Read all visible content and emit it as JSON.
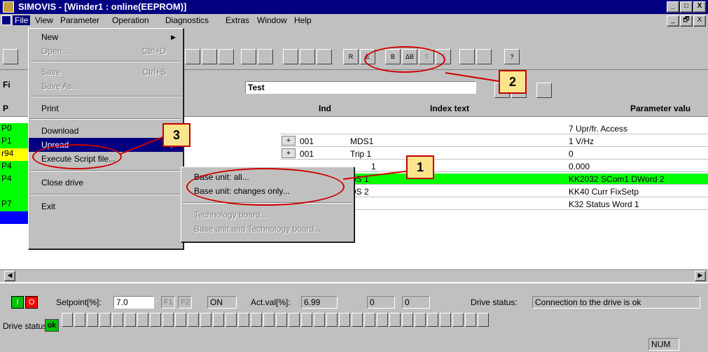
{
  "window": {
    "title": "SIMOVIS  -  [Winder1 : online(EEPROM)]",
    "controls": [
      "_",
      "□",
      "X"
    ],
    "child_controls": [
      "_",
      "🗗",
      "X"
    ]
  },
  "menubar": [
    "File",
    "View",
    "Parameter",
    "Operation",
    "Diagnostics",
    "Extras",
    "Window",
    "Help"
  ],
  "file_menu": {
    "new": "New",
    "open": "Open...",
    "open_shortcut": "Ctrl+D",
    "save": "Save",
    "save_shortcut": "Ctrl+S",
    "save_as": "Save As...",
    "print": "Print",
    "download": "Download",
    "upread": "Upread",
    "execute_script": "Execute Script file...",
    "close_drive": "Close drive",
    "exit": "Exit"
  },
  "upread_submenu": {
    "base_all": "Base unit: all...",
    "base_changes": "Base unit: changes only...",
    "tech_board": "Technology board...",
    "base_and_tech": "Base unit and Technology board..."
  },
  "toolbar": {
    "filter_field": "Test",
    "left_label": "Fi",
    "icons": [
      "R",
      "E",
      "B",
      "ΔB",
      "T",
      "T",
      "?"
    ]
  },
  "grid": {
    "headers": {
      "p": "P",
      "ind": "Ind",
      "index_text": "Index text",
      "param_value": "Parameter valu"
    },
    "left_rows": [
      "P0",
      "P1",
      "r94",
      "P4",
      "P4",
      "",
      "P7"
    ],
    "rows": [
      {
        "plus": "",
        "ind": "",
        "text": "",
        "value": "7   Upr/fr. Access"
      },
      {
        "plus": "+",
        "ind": "001",
        "text": "MDS1",
        "value": "1   V/Hz"
      },
      {
        "plus": "+",
        "ind": "001",
        "text": "Trip 1",
        "value": "0"
      },
      {
        "plus": "",
        "ind": "",
        "text": "1",
        "value": "0.000"
      },
      {
        "plus": "",
        "ind": "",
        "text": "DS 1",
        "value": "KK2032  SCom1 DWord  2"
      },
      {
        "plus": "",
        "ind": "",
        "text": "DS 2",
        "value": "KK40  Curr FixSetp"
      },
      {
        "plus": "",
        "ind": "",
        "text": "",
        "value": "K32  Status Word 1"
      }
    ]
  },
  "statusbar": {
    "setpoint_label": "Setpoint[%]:",
    "setpoint_value": "7.0",
    "f1": "F1",
    "f2": "F2",
    "on_label": "ON",
    "actval_label": "Act.val[%]:",
    "actval_value": "6.99",
    "field_a": "0",
    "field_b": "0",
    "drive_status_label": "Drive status:",
    "drive_status_text": "Connection to the drive is ok",
    "drive_status_label2": "Drive status:",
    "ok": "ok",
    "num": "NUM"
  },
  "callouts": [
    "1",
    "2",
    "3"
  ],
  "colors": {
    "title_bg": "#000080",
    "green_row": "#00ff00",
    "callout_fill": "#fce48c",
    "callout_border": "#c00000"
  }
}
